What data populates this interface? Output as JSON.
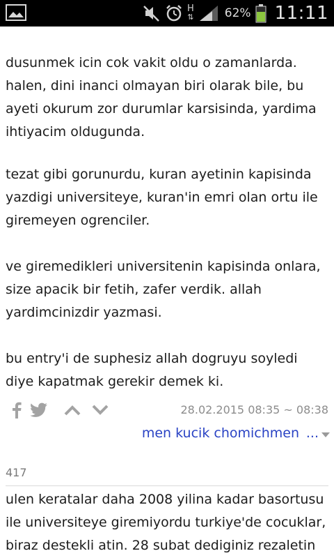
{
  "status_bar": {
    "battery_percent": "62%",
    "time": "11:11",
    "network_label": "H",
    "icons": [
      "gallery-icon",
      "mute-icon",
      "alarm-icon",
      "h-network-icon",
      "signal-icon",
      "battery-icon"
    ],
    "battery_level": 0.62,
    "battery_color": "#8cc63f"
  },
  "entry": {
    "paragraphs": [
      "dusunmek icin cok vakit oldu o zamanlarda. halen, dini inanci olmayan biri olarak bile, bu ayeti okurum zor durumlar karsisinda, yardima ihtiyacim oldugunda.",
      "tezat gibi gorunurdu, kuran ayetinin kapisinda yazdigi universiteye, kuran'in emri olan ortu ile giremeyen ogrenciler.",
      "ve giremedikleri universitenin kapisinda onlara, size apacik bir fetih, zafer verdik. allah yardimcinizdir yazmasi.",
      "bu entry'i de suphesiz allah dogruyu soyledi diye kapatmak gerekir demek ki."
    ],
    "date": "28.02.2015 08:35 ~ 08:38",
    "author": "men kucik chomichmen",
    "more_label": "...",
    "action_icons": [
      "facebook-icon",
      "twitter-icon",
      "upvote-icon",
      "downvote-icon"
    ]
  },
  "next_entry": {
    "number": "417",
    "text": "ulen keratalar daha 2008 yilina kadar basortusu ile universiteye giremiyordu turkiye'de cocuklar, biraz destekli atin. 28 subat dediginiz rezaletin"
  },
  "colors": {
    "author_link": "#2a43c4",
    "meta_gray": "#8c8c8c",
    "icon_gray": "#9a9a9a"
  }
}
